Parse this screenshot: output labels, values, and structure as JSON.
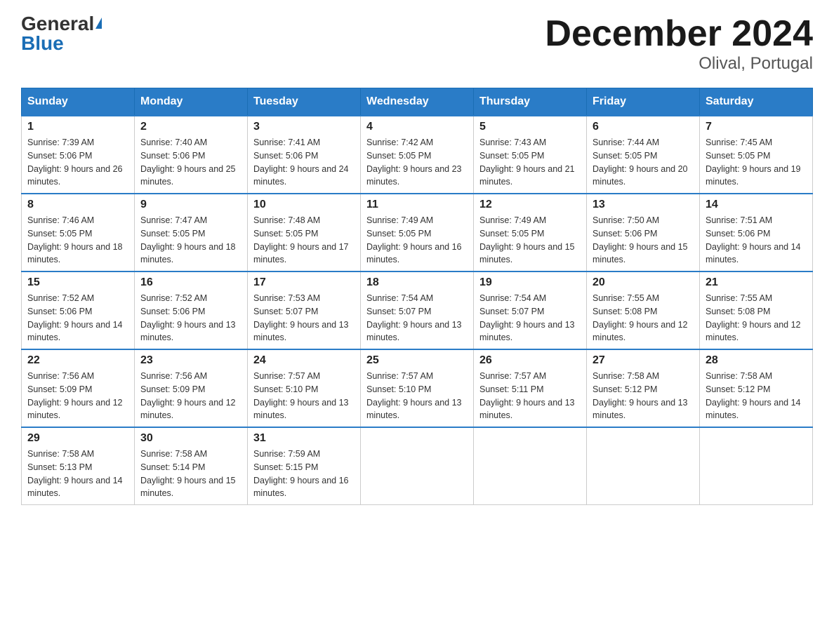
{
  "header": {
    "logo_general": "General",
    "logo_blue": "Blue",
    "month_title": "December 2024",
    "location": "Olival, Portugal"
  },
  "weekdays": [
    "Sunday",
    "Monday",
    "Tuesday",
    "Wednesday",
    "Thursday",
    "Friday",
    "Saturday"
  ],
  "weeks": [
    [
      {
        "day": "1",
        "sunrise": "7:39 AM",
        "sunset": "5:06 PM",
        "daylight": "9 hours and 26 minutes."
      },
      {
        "day": "2",
        "sunrise": "7:40 AM",
        "sunset": "5:06 PM",
        "daylight": "9 hours and 25 minutes."
      },
      {
        "day": "3",
        "sunrise": "7:41 AM",
        "sunset": "5:06 PM",
        "daylight": "9 hours and 24 minutes."
      },
      {
        "day": "4",
        "sunrise": "7:42 AM",
        "sunset": "5:05 PM",
        "daylight": "9 hours and 23 minutes."
      },
      {
        "day": "5",
        "sunrise": "7:43 AM",
        "sunset": "5:05 PM",
        "daylight": "9 hours and 21 minutes."
      },
      {
        "day": "6",
        "sunrise": "7:44 AM",
        "sunset": "5:05 PM",
        "daylight": "9 hours and 20 minutes."
      },
      {
        "day": "7",
        "sunrise": "7:45 AM",
        "sunset": "5:05 PM",
        "daylight": "9 hours and 19 minutes."
      }
    ],
    [
      {
        "day": "8",
        "sunrise": "7:46 AM",
        "sunset": "5:05 PM",
        "daylight": "9 hours and 18 minutes."
      },
      {
        "day": "9",
        "sunrise": "7:47 AM",
        "sunset": "5:05 PM",
        "daylight": "9 hours and 18 minutes."
      },
      {
        "day": "10",
        "sunrise": "7:48 AM",
        "sunset": "5:05 PM",
        "daylight": "9 hours and 17 minutes."
      },
      {
        "day": "11",
        "sunrise": "7:49 AM",
        "sunset": "5:05 PM",
        "daylight": "9 hours and 16 minutes."
      },
      {
        "day": "12",
        "sunrise": "7:49 AM",
        "sunset": "5:05 PM",
        "daylight": "9 hours and 15 minutes."
      },
      {
        "day": "13",
        "sunrise": "7:50 AM",
        "sunset": "5:06 PM",
        "daylight": "9 hours and 15 minutes."
      },
      {
        "day": "14",
        "sunrise": "7:51 AM",
        "sunset": "5:06 PM",
        "daylight": "9 hours and 14 minutes."
      }
    ],
    [
      {
        "day": "15",
        "sunrise": "7:52 AM",
        "sunset": "5:06 PM",
        "daylight": "9 hours and 14 minutes."
      },
      {
        "day": "16",
        "sunrise": "7:52 AM",
        "sunset": "5:06 PM",
        "daylight": "9 hours and 13 minutes."
      },
      {
        "day": "17",
        "sunrise": "7:53 AM",
        "sunset": "5:07 PM",
        "daylight": "9 hours and 13 minutes."
      },
      {
        "day": "18",
        "sunrise": "7:54 AM",
        "sunset": "5:07 PM",
        "daylight": "9 hours and 13 minutes."
      },
      {
        "day": "19",
        "sunrise": "7:54 AM",
        "sunset": "5:07 PM",
        "daylight": "9 hours and 13 minutes."
      },
      {
        "day": "20",
        "sunrise": "7:55 AM",
        "sunset": "5:08 PM",
        "daylight": "9 hours and 12 minutes."
      },
      {
        "day": "21",
        "sunrise": "7:55 AM",
        "sunset": "5:08 PM",
        "daylight": "9 hours and 12 minutes."
      }
    ],
    [
      {
        "day": "22",
        "sunrise": "7:56 AM",
        "sunset": "5:09 PM",
        "daylight": "9 hours and 12 minutes."
      },
      {
        "day": "23",
        "sunrise": "7:56 AM",
        "sunset": "5:09 PM",
        "daylight": "9 hours and 12 minutes."
      },
      {
        "day": "24",
        "sunrise": "7:57 AM",
        "sunset": "5:10 PM",
        "daylight": "9 hours and 13 minutes."
      },
      {
        "day": "25",
        "sunrise": "7:57 AM",
        "sunset": "5:10 PM",
        "daylight": "9 hours and 13 minutes."
      },
      {
        "day": "26",
        "sunrise": "7:57 AM",
        "sunset": "5:11 PM",
        "daylight": "9 hours and 13 minutes."
      },
      {
        "day": "27",
        "sunrise": "7:58 AM",
        "sunset": "5:12 PM",
        "daylight": "9 hours and 13 minutes."
      },
      {
        "day": "28",
        "sunrise": "7:58 AM",
        "sunset": "5:12 PM",
        "daylight": "9 hours and 14 minutes."
      }
    ],
    [
      {
        "day": "29",
        "sunrise": "7:58 AM",
        "sunset": "5:13 PM",
        "daylight": "9 hours and 14 minutes."
      },
      {
        "day": "30",
        "sunrise": "7:58 AM",
        "sunset": "5:14 PM",
        "daylight": "9 hours and 15 minutes."
      },
      {
        "day": "31",
        "sunrise": "7:59 AM",
        "sunset": "5:15 PM",
        "daylight": "9 hours and 16 minutes."
      },
      null,
      null,
      null,
      null
    ]
  ]
}
